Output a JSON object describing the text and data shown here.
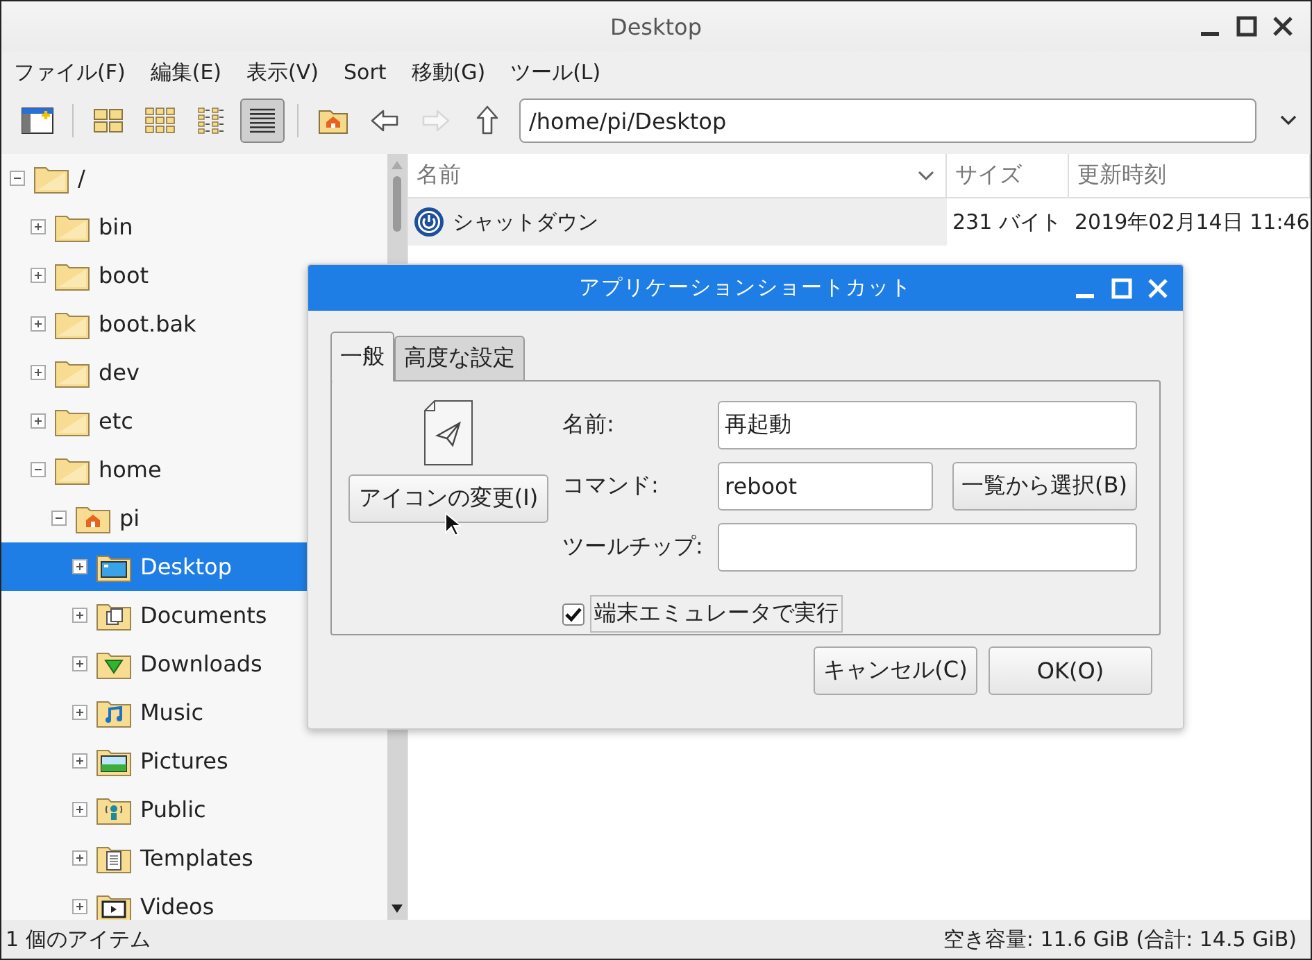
{
  "window": {
    "title": "Desktop"
  },
  "menu": [
    "ファイル(F)",
    "編集(E)",
    "表示(V)",
    "Sort",
    "移動(G)",
    "ツール(L)"
  ],
  "view_modes": [
    {
      "kind": "icons",
      "selected": false
    },
    {
      "kind": "thumbnails",
      "selected": false
    },
    {
      "kind": "compact",
      "selected": false
    },
    {
      "kind": "list",
      "selected": true
    }
  ],
  "nav_buttons": [
    {
      "kind": "home",
      "disabled": false
    },
    {
      "kind": "back",
      "disabled": false
    },
    {
      "kind": "forward",
      "disabled": true
    },
    {
      "kind": "up",
      "disabled": false
    }
  ],
  "location": {
    "value": "/home/pi/Desktop"
  },
  "tree": [
    {
      "label": "/",
      "kind": "folder",
      "expanded": true,
      "selected": false,
      "children": [
        {
          "label": "bin",
          "kind": "folder",
          "expanded": false,
          "selected": false
        },
        {
          "label": "boot",
          "kind": "folder",
          "expanded": false,
          "selected": false
        },
        {
          "label": "boot.bak",
          "kind": "folder",
          "expanded": false,
          "selected": false
        },
        {
          "label": "dev",
          "kind": "folder",
          "expanded": false,
          "selected": false
        },
        {
          "label": "etc",
          "kind": "folder",
          "expanded": false,
          "selected": false
        },
        {
          "label": "home",
          "kind": "folder",
          "expanded": true,
          "selected": false,
          "children": [
            {
              "label": "pi",
              "kind": "home",
              "expanded": true,
              "selected": false,
              "children": [
                {
                  "label": "Desktop",
                  "kind": "desktop",
                  "expanded": false,
                  "selected": true
                },
                {
                  "label": "Documents",
                  "kind": "documents",
                  "expanded": false,
                  "selected": false
                },
                {
                  "label": "Downloads",
                  "kind": "downloads",
                  "expanded": false,
                  "selected": false
                },
                {
                  "label": "Music",
                  "kind": "music",
                  "expanded": false,
                  "selected": false
                },
                {
                  "label": "Pictures",
                  "kind": "pictures",
                  "expanded": false,
                  "selected": false
                },
                {
                  "label": "Public",
                  "kind": "public",
                  "expanded": false,
                  "selected": false
                },
                {
                  "label": "Templates",
                  "kind": "templates",
                  "expanded": false,
                  "selected": false
                },
                {
                  "label": "Videos",
                  "kind": "videos",
                  "expanded": false,
                  "selected": false
                }
              ]
            }
          ]
        }
      ]
    }
  ],
  "file_list": {
    "columns": [
      "名前",
      "サイズ",
      "更新時刻"
    ],
    "rows": [
      {
        "name": "シャットダウン",
        "size": "231 バイト",
        "modified": "2019年02月14日 11:46"
      }
    ]
  },
  "status_bar": {
    "left": "1 個のアイテム",
    "right": "空き容量: 11.6 GiB (合計: 14.5 GiB)"
  },
  "dialog": {
    "title": "アプリケーションショートカット",
    "tabs": [
      {
        "label": "一般",
        "selected": true
      },
      {
        "label": "高度な設定",
        "selected": false
      }
    ],
    "change_icon_button": "アイコンの変更(I)",
    "fields": [
      {
        "label": "名前:",
        "value": "再起動"
      },
      {
        "label": "コマンド:",
        "value": "reboot",
        "button": "一覧から選択(B)"
      },
      {
        "label": "ツールチップ:"
      }
    ],
    "checkbox": {
      "label": "端末エミュレータで実行",
      "checked": true
    },
    "buttons": [
      "キャンセル(C)",
      "OK(O)"
    ]
  }
}
